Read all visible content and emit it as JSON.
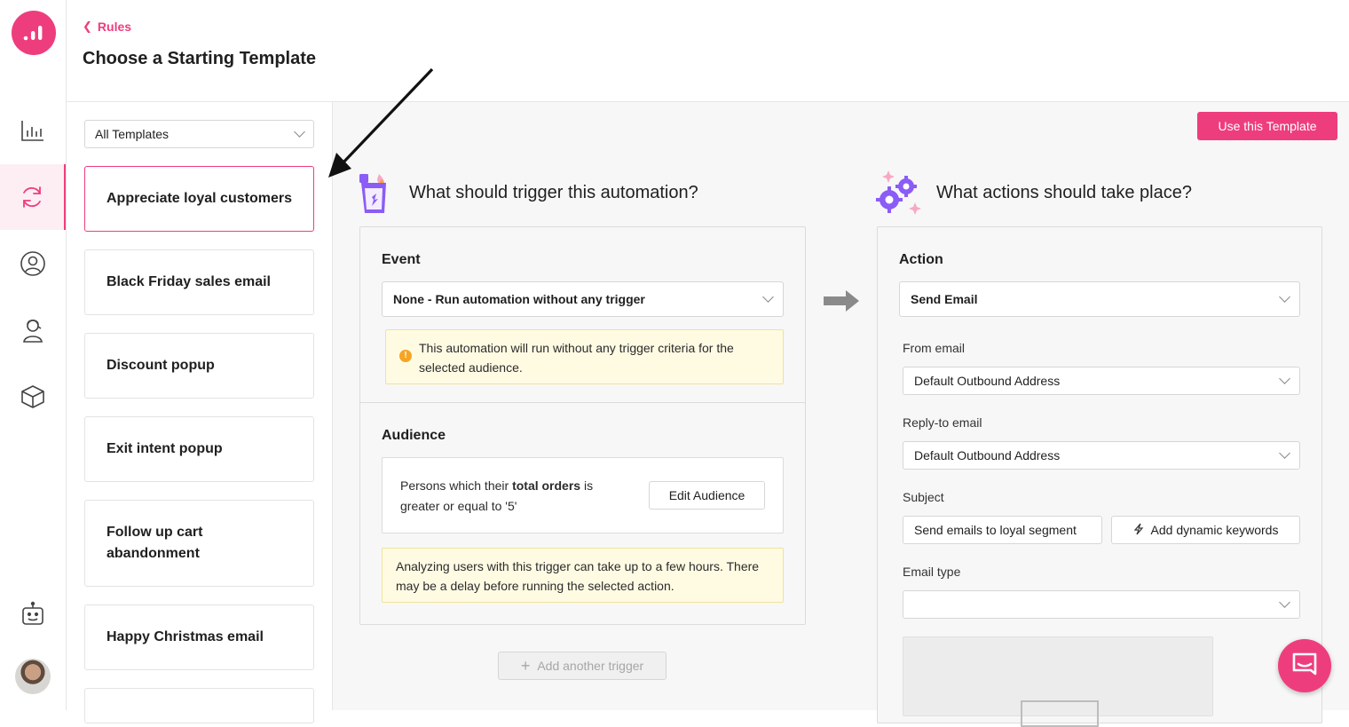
{
  "header": {
    "back_label": "Rules",
    "title": "Choose a Starting Template"
  },
  "rail": {
    "icons": [
      "analytics-logo-icon",
      "bar-chart-icon",
      "automation-cycle-icon",
      "user-circle-icon",
      "agent-icon",
      "box-icon",
      "bot-icon"
    ]
  },
  "templates": {
    "filter_value": "All Templates",
    "items": [
      {
        "label": "Appreciate loyal customers"
      },
      {
        "label": "Black Friday sales email"
      },
      {
        "label": "Discount popup"
      },
      {
        "label": "Exit intent popup"
      },
      {
        "label": "Follow up cart abandonment"
      },
      {
        "label": "Happy Christmas email"
      }
    ]
  },
  "toolbar": {
    "use_template_label": "Use this Template"
  },
  "trigger": {
    "title": "What should trigger this automation?",
    "event_label": "Event",
    "event_value": "None - Run automation without any trigger",
    "event_note": "This automation will run without any trigger criteria for the selected audience.",
    "audience_label": "Audience",
    "audience_text_pre": "Persons which their ",
    "audience_text_bold": "total orders",
    "audience_text_post": " is greater or equal to '5'",
    "edit_audience_label": "Edit Audience",
    "audience_note": "Analyzing users with this trigger can take up to a few hours. There may be a delay before running the selected action.",
    "add_trigger_label": "Add another trigger"
  },
  "actions": {
    "title": "What actions should take place?",
    "action_label": "Action",
    "action_value": "Send Email",
    "from_label": "From email",
    "from_value": "Default Outbound Address",
    "reply_label": "Reply-to email",
    "reply_value": "Default Outbound Address",
    "subject_label": "Subject",
    "subject_value": "Send emails to loyal segment",
    "dynamic_keywords_label": "Add dynamic keywords",
    "email_type_label": "Email type",
    "email_type_value": ""
  },
  "colors": {
    "accent": "#ee3d7d",
    "note_bg": "#fffbe3",
    "warning": "#f5a524"
  }
}
